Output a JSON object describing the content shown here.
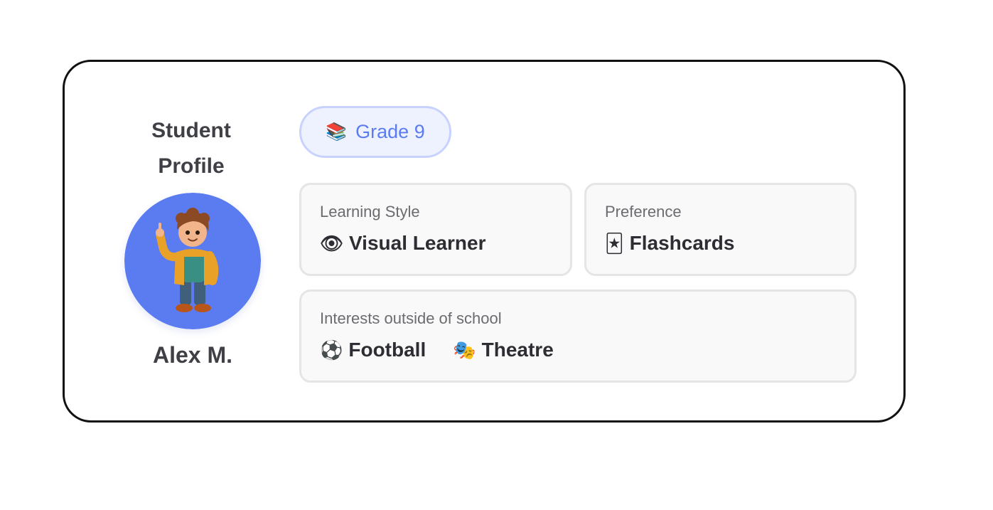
{
  "profile": {
    "title_line1": "Student",
    "title_line2": "Profile",
    "name": "Alex M.",
    "avatar_color": "#5b7cf0"
  },
  "grade": {
    "icon": "books-icon",
    "icon_glyph": "📚",
    "label": "Grade 9"
  },
  "learning_style": {
    "label": "Learning Style",
    "icon": "eye-icon",
    "icon_glyph": "👁",
    "value": "Visual Learner"
  },
  "preference": {
    "label": "Preference",
    "icon": "flashcard-icon",
    "icon_glyph": "🃏",
    "value": "Flashcards"
  },
  "interests": {
    "label": "Interests outside of school",
    "items": [
      {
        "icon": "soccer-ball-icon",
        "icon_glyph": "⚽",
        "label": "Football"
      },
      {
        "icon": "theatre-masks-icon",
        "icon_glyph": "🎭",
        "label": "Theatre"
      }
    ]
  }
}
